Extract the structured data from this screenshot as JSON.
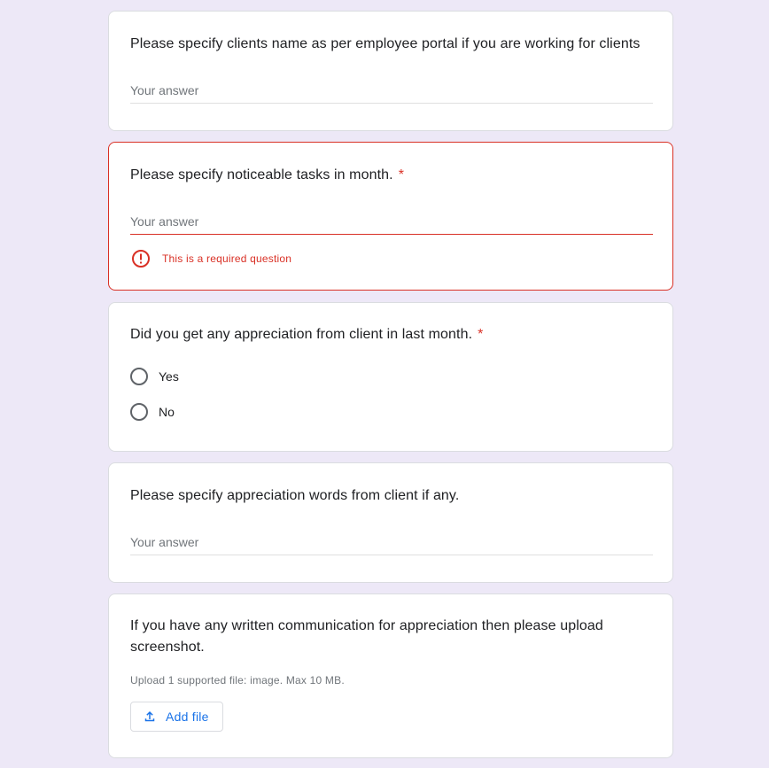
{
  "questions": [
    {
      "title": "Please specify clients name as per employee portal if you are working for clients",
      "placeholder": "Your answer"
    },
    {
      "title": "Please specify noticeable tasks in month.",
      "required_mark": "*",
      "placeholder": "Your answer",
      "error": "This is a required question"
    },
    {
      "title": "Did you get any appreciation from client in last month.",
      "required_mark": "*",
      "options": [
        "Yes",
        "No"
      ]
    },
    {
      "title": "Please specify appreciation words from client if any.",
      "placeholder": "Your answer"
    },
    {
      "title": "If you have any written communication for appreciation then please upload screenshot.",
      "hint": "Upload 1 supported file: image. Max 10 MB.",
      "button_label": "Add file"
    }
  ],
  "colors": {
    "background": "#ede8f7",
    "error": "#d93025",
    "link_blue": "#1a73e8"
  },
  "icons": {
    "error": "error-circle-icon",
    "upload": "upload-icon"
  }
}
